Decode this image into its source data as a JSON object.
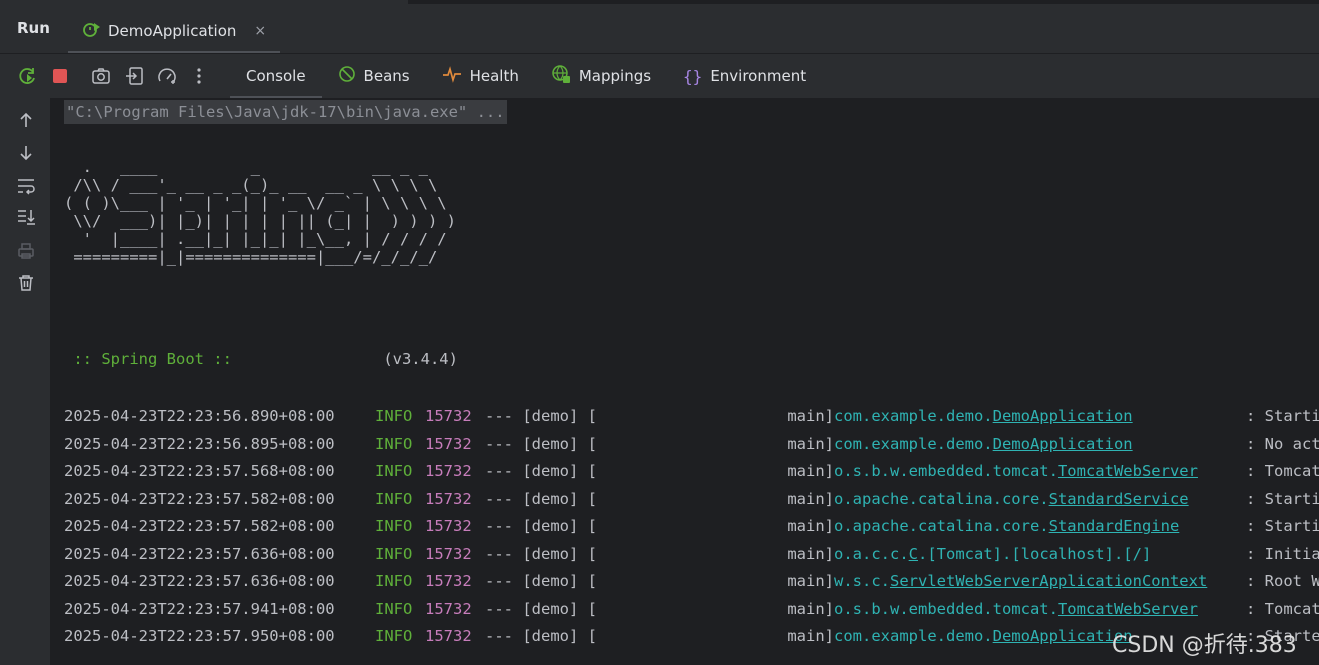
{
  "header": {
    "run_label": "Run",
    "tab_title": "DemoApplication",
    "close_glyph": "×"
  },
  "toolbar": {
    "icons": [
      "rerun-icon",
      "stop-icon",
      "screenshot-icon",
      "restore-layout-icon",
      "performance-icon",
      "more-icon"
    ],
    "tabs": [
      {
        "label": "Console",
        "icon": "",
        "active": true
      },
      {
        "label": "Beans",
        "icon": "beans-icon"
      },
      {
        "label": "Health",
        "icon": "health-icon"
      },
      {
        "label": "Mappings",
        "icon": "mappings-icon"
      },
      {
        "label": "Environment",
        "icon": "environment-icon"
      }
    ]
  },
  "gutter": {
    "icons": [
      "scroll-up-icon",
      "scroll-down-icon",
      "soft-wrap-icon",
      "scroll-to-end-icon",
      "print-icon",
      "clear-all-icon"
    ]
  },
  "console": {
    "command": "\"C:\\Program Files\\Java\\jdk-17\\bin\\java.exe\" ...",
    "banner": "  .   ____          _            __ _ _\n /\\\\ / ___'_ __ _ _(_)_ __  __ _ \\ \\ \\ \\\n( ( )\\___ | '_ | '_| | '_ \\/ _` | \\ \\ \\ \\\n \\\\/  ___)| |_)| | | | | || (_| |  ) ) ) )\n  '  |____| .__|_| |_|_| |_\\__, | / / / /\n =========|_|==============|___/=/_/_/_/",
    "spring_boot_label": " :: Spring Boot :: ",
    "spring_boot_version": "(v3.4.4)",
    "logs": [
      {
        "ts": "2025-04-23T22:23:56.890+08:00",
        "level": "INFO",
        "pid": "15732",
        "sep": "--- [demo] [",
        "thread": "main]",
        "logger_prefix": "com.example.demo.",
        "logger_class": "DemoApplication",
        "msg": ": Starting Dem"
      },
      {
        "ts": "2025-04-23T22:23:56.895+08:00",
        "level": "INFO",
        "pid": "15732",
        "sep": "--- [demo] [",
        "thread": "main]",
        "logger_prefix": "com.example.demo.",
        "logger_class": "DemoApplication",
        "msg": ": No active pr"
      },
      {
        "ts": "2025-04-23T22:23:57.568+08:00",
        "level": "INFO",
        "pid": "15732",
        "sep": "--- [demo] [",
        "thread": "main]",
        "logger_prefix": "o.s.b.w.embedded.tomcat.",
        "logger_class": "TomcatWebServer",
        "msg": ": Tomcat initi"
      },
      {
        "ts": "2025-04-23T22:23:57.582+08:00",
        "level": "INFO",
        "pid": "15732",
        "sep": "--- [demo] [",
        "thread": "main]",
        "logger_prefix": "o.apache.catalina.core.",
        "logger_class": "StandardService",
        "msg": ": Starting ser"
      },
      {
        "ts": "2025-04-23T22:23:57.582+08:00",
        "level": "INFO",
        "pid": "15732",
        "sep": "--- [demo] [",
        "thread": "main]",
        "logger_prefix": "o.apache.catalina.core.",
        "logger_class": "StandardEngine",
        "msg": ": Starting Ser"
      },
      {
        "ts": "2025-04-23T22:23:57.636+08:00",
        "level": "INFO",
        "pid": "15732",
        "sep": "--- [demo] [",
        "thread": "main]",
        "logger_prefix": "o.a.c.c.",
        "logger_class": "C",
        "logger_suffix": ".[Tomcat].[localhost].[/]",
        "msg": ": Initializing"
      },
      {
        "ts": "2025-04-23T22:23:57.636+08:00",
        "level": "INFO",
        "pid": "15732",
        "sep": "--- [demo] [",
        "thread": "main]",
        "logger_prefix": "w.s.c.",
        "logger_class": "ServletWebServerApplicationContext",
        "msg": ": Root WebAppl"
      },
      {
        "ts": "2025-04-23T22:23:57.941+08:00",
        "level": "INFO",
        "pid": "15732",
        "sep": "--- [demo] [",
        "thread": "main]",
        "logger_prefix": "o.s.b.w.embedded.tomcat.",
        "logger_class": "TomcatWebServer",
        "msg": ": Tomcat start"
      },
      {
        "ts": "2025-04-23T22:23:57.950+08:00",
        "level": "INFO",
        "pid": "15732",
        "sep": "--- [demo] [",
        "thread": "main]",
        "logger_prefix": "com.example.demo.",
        "logger_class": "DemoApplication",
        "msg": ": Started Demo"
      }
    ]
  },
  "watermark": "CSDN @折待.383",
  "colors": {
    "info": "#5fb03a",
    "pid": "#c77dbb",
    "logger": "#2fb3b3",
    "stop": "#e05555",
    "accent_green": "#5fb03a"
  }
}
